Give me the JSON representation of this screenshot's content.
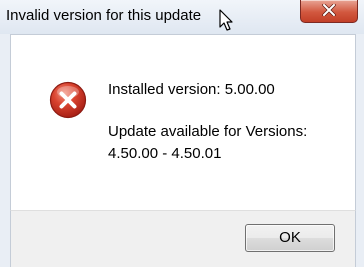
{
  "window": {
    "title": "Invalid version for this update"
  },
  "message": {
    "installed_line": "Installed version: 5.00.00",
    "available_line": "Update available for Versions:",
    "range_line": "4.50.00 - 4.50.01"
  },
  "buttons": {
    "ok_label": "OK"
  },
  "icons": {
    "status": "error-icon",
    "close": "close-icon"
  },
  "colors": {
    "error_red": "#c8382a",
    "close_button_red": "#d2583f"
  }
}
